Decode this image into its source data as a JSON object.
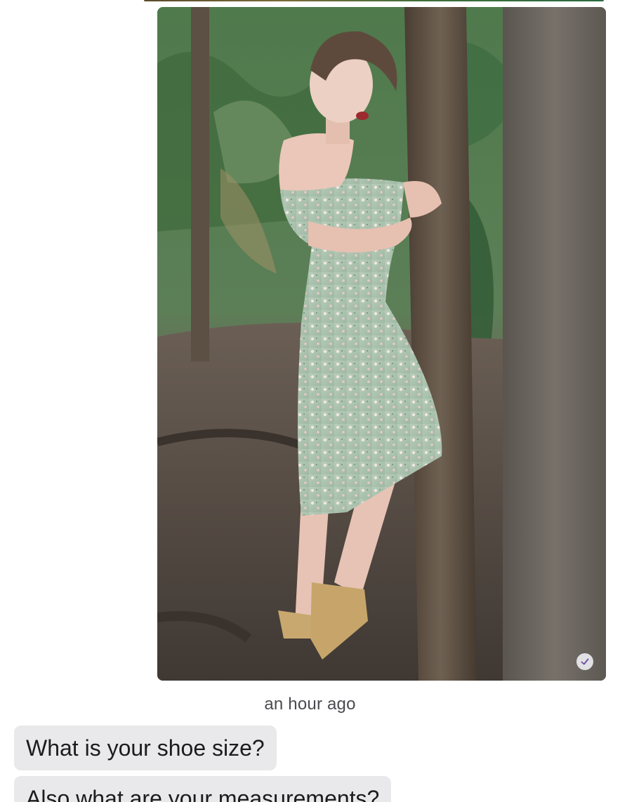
{
  "conversation": {
    "photo_message": {
      "description_icon": "photo",
      "status_icon": "checkmark-read-icon"
    },
    "timestamp": "an hour ago",
    "incoming_messages": [
      {
        "text": "What is your shoe size?"
      },
      {
        "text": "Also what are your measurements?"
      }
    ]
  },
  "colors": {
    "incoming_bubble": "#e9e9eb",
    "text": "#1c1c1e",
    "timestamp": "#4a4a4f",
    "read_check": "#6a4c9c"
  }
}
